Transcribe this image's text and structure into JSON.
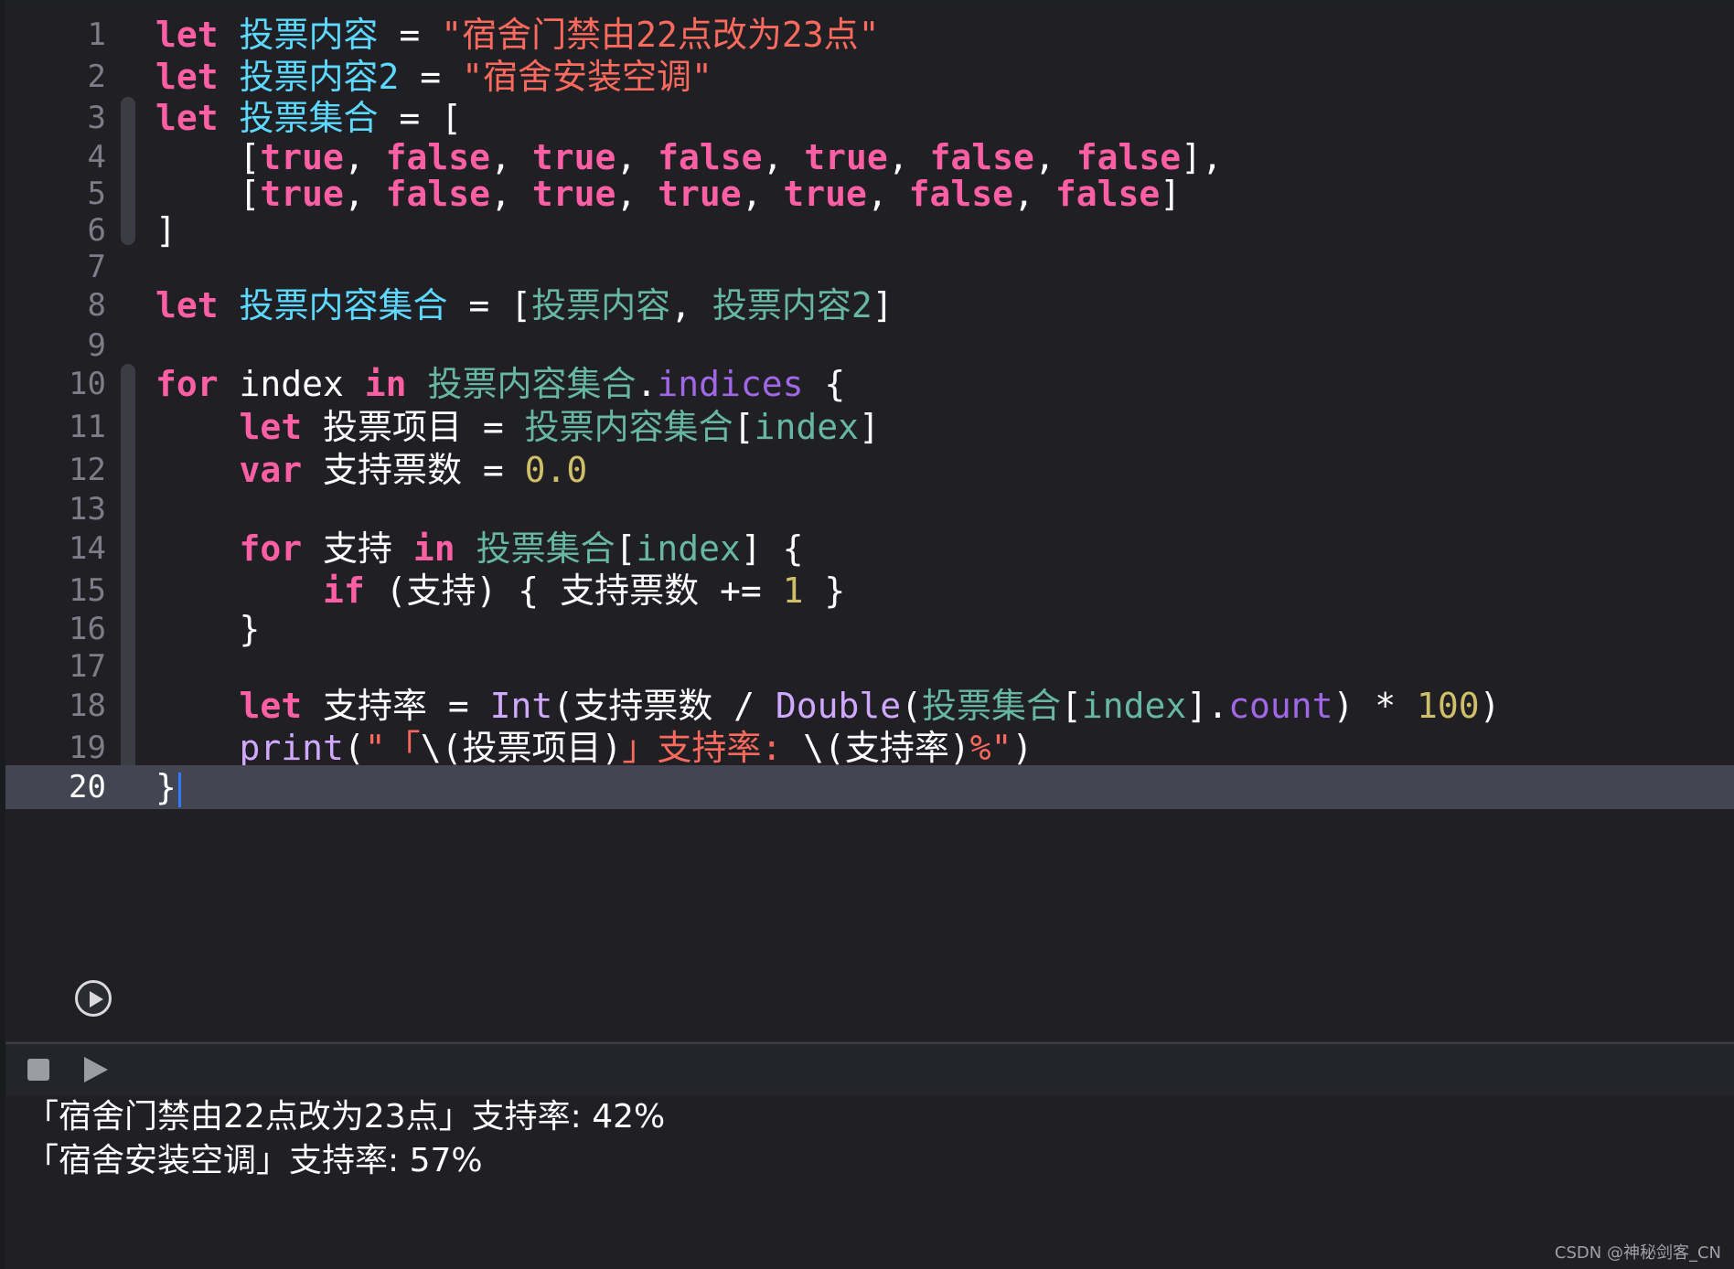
{
  "editor": {
    "current_line": "20",
    "lines": [
      {
        "n": "1",
        "t": [
          [
            "kw",
            "let"
          ],
          [
            "plain",
            " "
          ],
          [
            "decl",
            "投票内容"
          ],
          [
            "plain",
            " = "
          ],
          [
            "str",
            "\"宿舍门禁由22点改为23点\""
          ]
        ]
      },
      {
        "n": "2",
        "t": [
          [
            "kw",
            "let"
          ],
          [
            "plain",
            " "
          ],
          [
            "decl",
            "投票内容2"
          ],
          [
            "plain",
            " = "
          ],
          [
            "str",
            "\"宿舍安装空调\""
          ]
        ]
      },
      {
        "n": "3",
        "t": [
          [
            "kw",
            "let"
          ],
          [
            "plain",
            " "
          ],
          [
            "decl",
            "投票集合"
          ],
          [
            "plain",
            " = ["
          ]
        ]
      },
      {
        "n": "4",
        "t": [
          [
            "plain",
            "    ["
          ],
          [
            "lit",
            "true"
          ],
          [
            "plain",
            ", "
          ],
          [
            "lit",
            "false"
          ],
          [
            "plain",
            ", "
          ],
          [
            "lit",
            "true"
          ],
          [
            "plain",
            ", "
          ],
          [
            "lit",
            "false"
          ],
          [
            "plain",
            ", "
          ],
          [
            "lit",
            "true"
          ],
          [
            "plain",
            ", "
          ],
          [
            "lit",
            "false"
          ],
          [
            "plain",
            ", "
          ],
          [
            "lit",
            "false"
          ],
          [
            "plain",
            "],"
          ]
        ]
      },
      {
        "n": "5",
        "t": [
          [
            "plain",
            "    ["
          ],
          [
            "lit",
            "true"
          ],
          [
            "plain",
            ", "
          ],
          [
            "lit",
            "false"
          ],
          [
            "plain",
            ", "
          ],
          [
            "lit",
            "true"
          ],
          [
            "plain",
            ", "
          ],
          [
            "lit",
            "true"
          ],
          [
            "plain",
            ", "
          ],
          [
            "lit",
            "true"
          ],
          [
            "plain",
            ", "
          ],
          [
            "lit",
            "false"
          ],
          [
            "plain",
            ", "
          ],
          [
            "lit",
            "false"
          ],
          [
            "plain",
            "]"
          ]
        ]
      },
      {
        "n": "6",
        "t": [
          [
            "plain",
            "]"
          ]
        ]
      },
      {
        "n": "7",
        "t": []
      },
      {
        "n": "8",
        "t": [
          [
            "kw",
            "let"
          ],
          [
            "plain",
            " "
          ],
          [
            "decl",
            "投票内容集合"
          ],
          [
            "plain",
            " = ["
          ],
          [
            "var",
            "投票内容"
          ],
          [
            "plain",
            ", "
          ],
          [
            "var",
            "投票内容2"
          ],
          [
            "plain",
            "]"
          ]
        ]
      },
      {
        "n": "9",
        "t": []
      },
      {
        "n": "10",
        "t": [
          [
            "kw",
            "for"
          ],
          [
            "plain",
            " index "
          ],
          [
            "kw",
            "in"
          ],
          [
            "plain",
            " "
          ],
          [
            "var",
            "投票内容集合"
          ],
          [
            "plain",
            "."
          ],
          [
            "mem",
            "indices"
          ],
          [
            "plain",
            " {"
          ]
        ]
      },
      {
        "n": "11",
        "t": [
          [
            "plain",
            "    "
          ],
          [
            "kw",
            "let"
          ],
          [
            "plain",
            " 投票项目 = "
          ],
          [
            "var",
            "投票内容集合"
          ],
          [
            "plain",
            "["
          ],
          [
            "var",
            "index"
          ],
          [
            "plain",
            "]"
          ]
        ]
      },
      {
        "n": "12",
        "t": [
          [
            "plain",
            "    "
          ],
          [
            "kw",
            "var"
          ],
          [
            "plain",
            " 支持票数 = "
          ],
          [
            "num",
            "0.0"
          ]
        ]
      },
      {
        "n": "13",
        "t": []
      },
      {
        "n": "14",
        "t": [
          [
            "plain",
            "    "
          ],
          [
            "kw",
            "for"
          ],
          [
            "plain",
            " 支持 "
          ],
          [
            "kw",
            "in"
          ],
          [
            "plain",
            " "
          ],
          [
            "var",
            "投票集合"
          ],
          [
            "plain",
            "["
          ],
          [
            "var",
            "index"
          ],
          [
            "plain",
            "] {"
          ]
        ]
      },
      {
        "n": "15",
        "t": [
          [
            "plain",
            "        "
          ],
          [
            "kw",
            "if"
          ],
          [
            "plain",
            " (支持) { 支持票数 += "
          ],
          [
            "num",
            "1"
          ],
          [
            "plain",
            " }"
          ]
        ]
      },
      {
        "n": "16",
        "t": [
          [
            "plain",
            "    }"
          ]
        ]
      },
      {
        "n": "17",
        "t": []
      },
      {
        "n": "18",
        "t": [
          [
            "plain",
            "    "
          ],
          [
            "kw",
            "let"
          ],
          [
            "plain",
            " 支持率 = "
          ],
          [
            "typ",
            "Int"
          ],
          [
            "plain",
            "(支持票数 / "
          ],
          [
            "typ",
            "Double"
          ],
          [
            "plain",
            "("
          ],
          [
            "var",
            "投票集合"
          ],
          [
            "plain",
            "["
          ],
          [
            "var",
            "index"
          ],
          [
            "plain",
            "]."
          ],
          [
            "mem",
            "count"
          ],
          [
            "plain",
            ") * "
          ],
          [
            "num",
            "100"
          ],
          [
            "plain",
            ")"
          ]
        ]
      },
      {
        "n": "19",
        "t": [
          [
            "plain",
            "    "
          ],
          [
            "typ",
            "print"
          ],
          [
            "plain",
            "("
          ],
          [
            "str",
            "\"「"
          ],
          [
            "plain",
            "\\(投票项目)"
          ],
          [
            "str",
            "」支持率: "
          ],
          [
            "plain",
            "\\(支持率)"
          ],
          [
            "str",
            "%\""
          ],
          [
            "plain",
            ")"
          ]
        ]
      },
      {
        "n": "20",
        "t": [
          [
            "plain",
            "}"
          ]
        ]
      }
    ]
  },
  "console": {
    "output": [
      "「宿舍门禁由22点改为23点」支持率: 42%",
      "「宿舍安装空调」支持率: 57%"
    ]
  },
  "watermark": "CSDN @神秘剑客_CN",
  "colors": {
    "editor_bg": "#1f1f24",
    "keyword": "#fc5fa3",
    "declaration": "#5dd8ff",
    "string": "#fc6a5d",
    "number": "#d0bf69",
    "variable": "#67b7a4",
    "member": "#a167e6",
    "type": "#d0a8ff",
    "current_line": "#444553",
    "cursor": "#2f7bff"
  }
}
